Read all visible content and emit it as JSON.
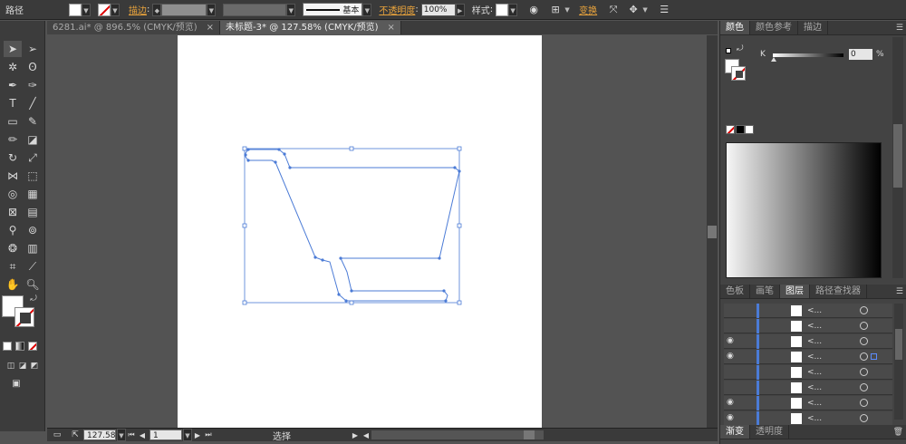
{
  "control_bar": {
    "object_type": "路径",
    "stroke_label": "描边",
    "stroke_profile": "基本",
    "opacity_label": "不透明度",
    "opacity_value": "100%",
    "style_label": "样式",
    "transform_label": "变换"
  },
  "tabs": [
    {
      "label": "6281.ai* @ 896.5% (CMYK/预览)",
      "active": false
    },
    {
      "label": "未标题-3* @ 127.58% (CMYK/预览)",
      "active": true
    }
  ],
  "status_bar": {
    "zoom": "127.58",
    "page": "1",
    "mode": "选择"
  },
  "color_panel": {
    "tabs": [
      "颜色",
      "颜色参考",
      "描边"
    ],
    "channel_label": "K",
    "channel_value": "0",
    "unit": "%"
  },
  "layers_panel": {
    "tabs": [
      "色板",
      "画笔",
      "图层",
      "路径查找器"
    ],
    "bottom_tabs": [
      "渐变",
      "透明度"
    ],
    "row_name": "<..."
  },
  "colors": {
    "accent": "#e8a33c",
    "path_blue": "#4b7bd6"
  }
}
